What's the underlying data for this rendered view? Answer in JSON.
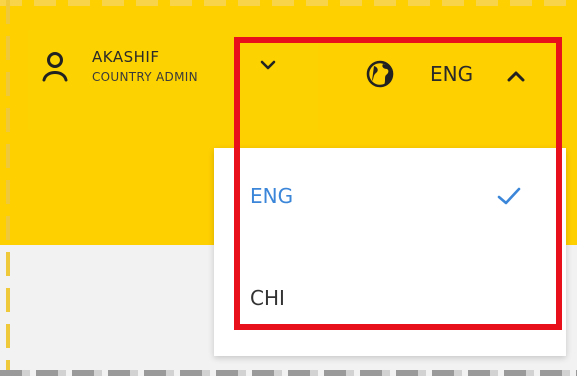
{
  "user": {
    "name": "AKASHIF",
    "role": "COUNTRY ADMIN"
  },
  "language": {
    "current": "ENG",
    "options": [
      {
        "label": "ENG",
        "selected": true
      },
      {
        "label": "CHI",
        "selected": false
      }
    ]
  },
  "icons": {
    "user": "user-icon",
    "user_menu": "chevron-down-icon",
    "language": "globe-icon",
    "language_menu": "chevron-up-icon",
    "selected": "check-icon"
  },
  "colors": {
    "header": "#ffd000",
    "selected_option": "#3b86d9",
    "highlight": "#e8101a"
  }
}
